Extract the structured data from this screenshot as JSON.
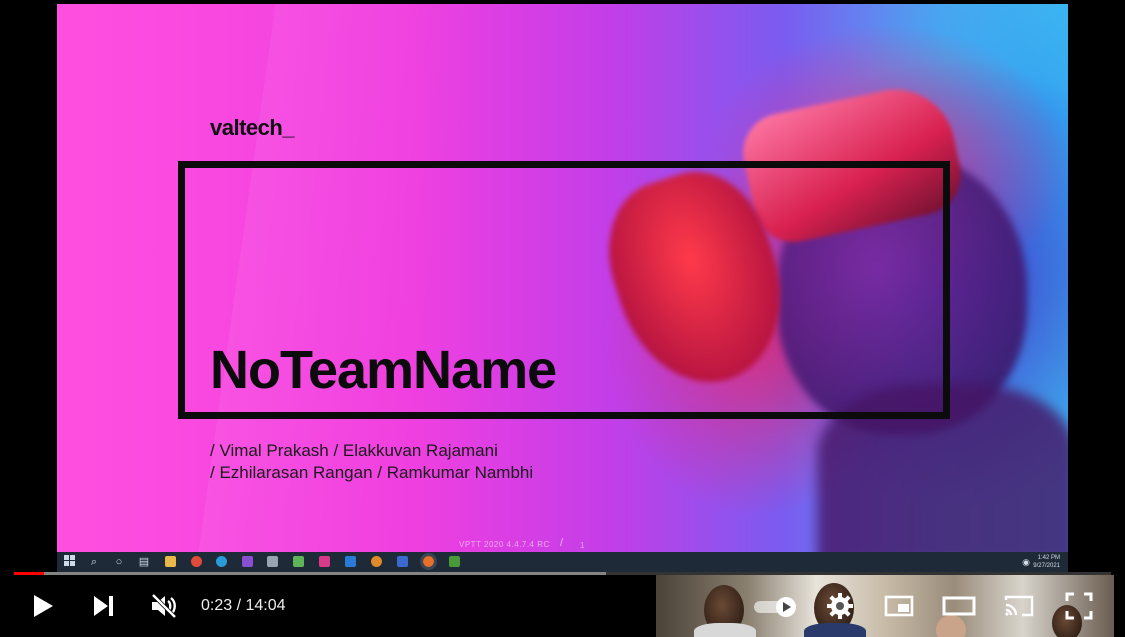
{
  "slide": {
    "logo": "valtech_",
    "team_name": "NoTeamName",
    "members_line1": "/ Vimal Prakash / Elakkuvan Rajamani",
    "members_line2": "/ Ezhilarasan Rangan / Ramkumar Nambhi",
    "version": "VPTT 2020 4.4.7.4 RC",
    "slash": "/",
    "page_number": "1"
  },
  "taskbar": {
    "time": "1:42 PM",
    "date": "9/27/2021",
    "icons": [
      "windows-start-icon",
      "search-icon",
      "cortana-icon",
      "task-view-icon",
      "file-explorer-icon",
      "chrome-icon",
      "edge-icon",
      "visual-studio-icon",
      "pen-icon",
      "notepad-icon",
      "unity-icon",
      "vscode-icon",
      "app-icon",
      "app-icon-2",
      "firefox-icon",
      "terminal-icon"
    ]
  },
  "player": {
    "time_current": "0:23",
    "time_separator": " / ",
    "time_total": "14:04",
    "progress_played": 0.027,
    "progress_loaded": 0.54,
    "muted": true
  },
  "colors": {
    "progress_red": "#ff0000",
    "slide_magenta": "#f03fe0",
    "slide_blue": "#3fc0f2"
  }
}
